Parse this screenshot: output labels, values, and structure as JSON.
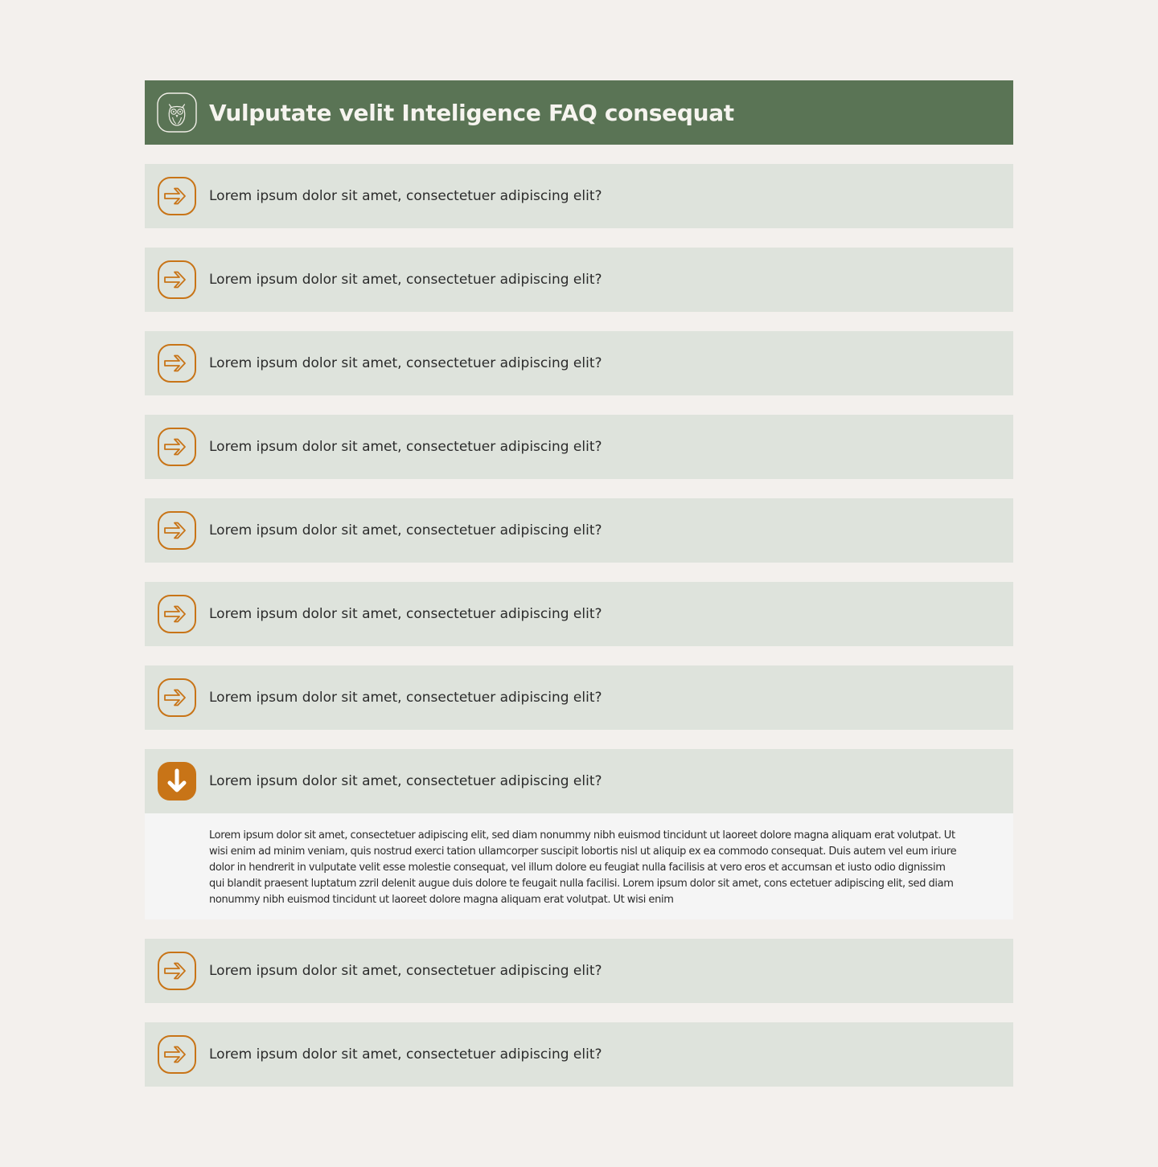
{
  "header": {
    "title": "Vulputate velit Inteligence FAQ consequat",
    "icon": "owl-icon"
  },
  "colors": {
    "header_bg": "#5a7455",
    "item_bg": "#dee3dc",
    "accent": "#c87417",
    "answer_bg": "#f5f5f5",
    "page_bg": "#f3f0ed"
  },
  "faq": {
    "items": [
      {
        "question": "Lorem ipsum dolor sit amet, consectetuer adipiscing elit?",
        "icon": "arrow-right-icon",
        "expanded": false
      },
      {
        "question": "Lorem ipsum dolor sit amet, consectetuer adipiscing elit?",
        "icon": "arrow-right-icon",
        "expanded": false
      },
      {
        "question": "Lorem ipsum dolor sit amet, consectetuer adipiscing elit?",
        "icon": "arrow-right-icon",
        "expanded": false
      },
      {
        "question": "Lorem ipsum dolor sit amet, consectetuer adipiscing elit?",
        "icon": "arrow-right-icon",
        "expanded": false
      },
      {
        "question": "Lorem ipsum dolor sit amet, consectetuer adipiscing elit?",
        "icon": "arrow-right-icon",
        "expanded": false
      },
      {
        "question": "Lorem ipsum dolor sit amet, consectetuer adipiscing elit?",
        "icon": "arrow-right-icon",
        "expanded": false
      },
      {
        "question": "Lorem ipsum dolor sit amet, consectetuer adipiscing elit?",
        "icon": "arrow-right-icon",
        "expanded": false
      },
      {
        "question": "Lorem ipsum dolor sit amet, consectetuer adipiscing elit?",
        "icon": "arrow-down-icon",
        "expanded": true,
        "answer": "Lorem ipsum dolor sit amet, consectetuer adipiscing elit, sed diam nonummy nibh euismod tincidunt ut laoreet dolore magna aliquam erat volutpat. Ut wisi enim ad minim veniam, quis nostrud exerci tation ullamcorper suscipit lobortis nisl ut aliquip ex ea commodo consequat. Duis autem vel eum iriure dolor in hendrerit in vulputate velit esse molestie consequat, vel illum dolore eu feugiat nulla facilisis at vero eros et accumsan et iusto odio dignissim qui blandit praesent luptatum zzril delenit augue duis dolore te feugait nulla facilisi. Lorem ipsum dolor sit amet, cons ectetuer adipiscing elit, sed diam nonummy nibh euismod tincidunt ut laoreet dolore magna aliquam erat volutpat. Ut wisi enim"
      },
      {
        "question": "Lorem ipsum dolor sit amet, consectetuer adipiscing elit?",
        "icon": "arrow-right-icon",
        "expanded": false
      },
      {
        "question": "Lorem ipsum dolor sit amet, consectetuer adipiscing elit?",
        "icon": "arrow-right-icon",
        "expanded": false
      }
    ]
  }
}
